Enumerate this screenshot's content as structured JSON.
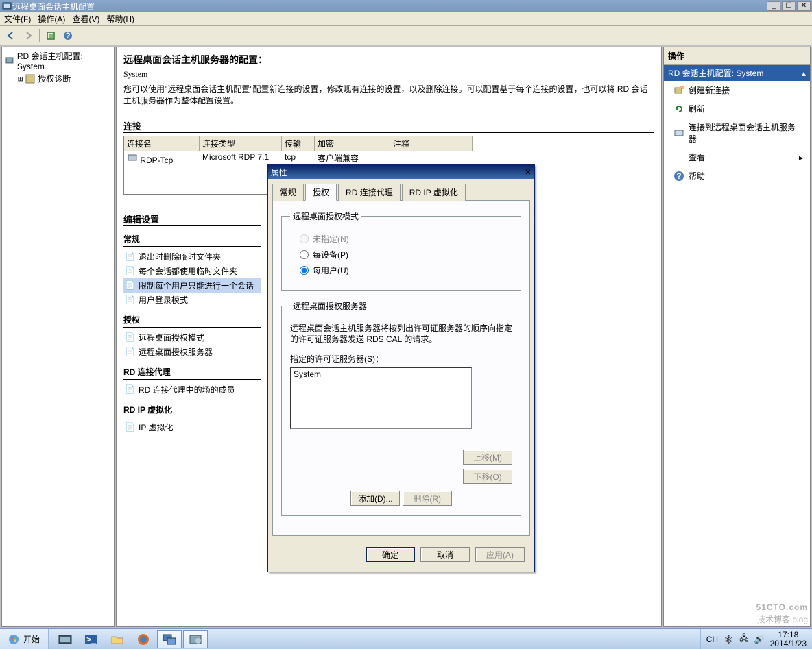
{
  "window": {
    "title": "远程桌面会话主机配置"
  },
  "menu": {
    "file": "文件(F)",
    "action": "操作(A)",
    "view": "查看(V)",
    "help": "帮助(H)"
  },
  "tree": {
    "root": "RD 会话主机配置: System",
    "child1": "授权诊断"
  },
  "center": {
    "heading": "远程桌面会话主机服务器的配置：",
    "system": "System",
    "desc": "您可以使用\"远程桌面会话主机配置\"配置新连接的设置，修改现有连接的设置，以及删除连接。可以配置基于每个连接的设置，也可以将 RD 会话主机服务器作为整体配置设置。",
    "conn_section": "连接",
    "table": {
      "h1": "连接名",
      "h2": "连接类型",
      "h3": "传输",
      "h4": "加密",
      "h5": "注释",
      "r1c1": "RDP-Tcp",
      "r1c2": "Microsoft RDP 7.1",
      "r1c3": "tcp",
      "r1c4": "客户端兼容",
      "r1c5": ""
    },
    "edit_section": "编辑设置",
    "grp_general": "常规",
    "items_general": {
      "i1": "退出时删除临时文件夹",
      "i2": "每个会话都使用临时文件夹",
      "i3": "限制每个用户只能进行一个会话",
      "i4": "用户登录模式"
    },
    "grp_license": "授权",
    "items_license": {
      "i1": "远程桌面授权模式",
      "i2": "远程桌面授权服务器"
    },
    "grp_broker": "RD 连接代理",
    "items_broker": {
      "i1": "RD 连接代理中的场的成员"
    },
    "grp_rdip": "RD IP 虚拟化",
    "items_rdip": {
      "i1": "IP 虚拟化"
    }
  },
  "actions": {
    "header": "操作",
    "bar": "RD 会话主机配置: System",
    "items": {
      "a1": "创建新连接",
      "a2": "刷新",
      "a3": "连接到远程桌面会话主机服务器",
      "a4": "查看",
      "a5": "帮助"
    }
  },
  "dialog": {
    "title": "属性",
    "tabs": {
      "t1": "常规",
      "t2": "授权",
      "t3": "RD 连接代理",
      "t4": "RD IP 虚拟化"
    },
    "group1": "远程桌面授权模式",
    "radios": {
      "r1": "未指定(N)",
      "r2": "每设备(P)",
      "r3": "每用户(U)"
    },
    "group2": "远程桌面授权服务器",
    "note": "远程桌面会话主机服务器将按列出许可证服务器的顺序向指定的许可证服务器发送 RDS CAL 的请求。",
    "list_label": "指定的许可证服务器(S)：",
    "list_item": "System",
    "btn_up": "上移(M)",
    "btn_down": "下移(O)",
    "btn_add": "添加(D)...",
    "btn_remove": "删除(R)",
    "ok": "确定",
    "cancel": "取消",
    "apply": "应用(A)"
  },
  "taskbar": {
    "start": "开始",
    "tray": {
      "lang": "CH",
      "time": "17:18",
      "date": "2014/1/23"
    }
  },
  "watermark": {
    "main": "51CTO.com",
    "sub": "技术博客 blog"
  }
}
